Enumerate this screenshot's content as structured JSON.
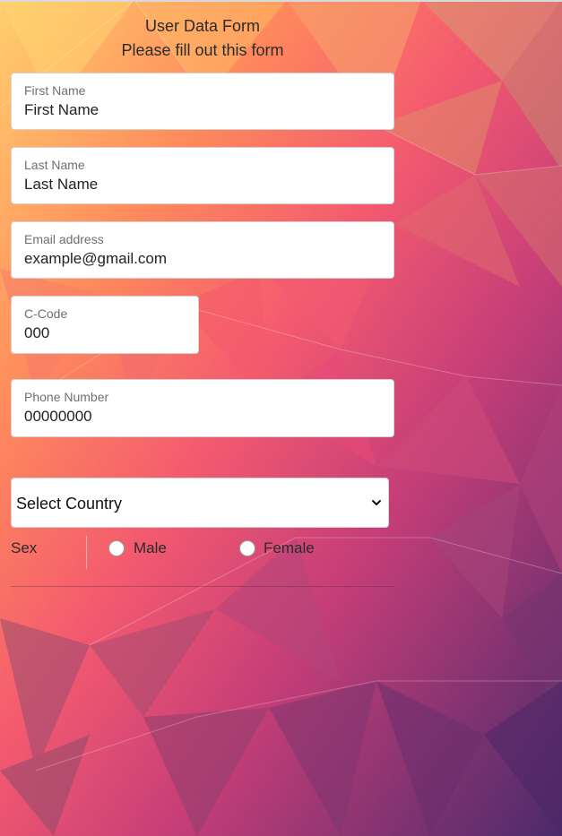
{
  "form": {
    "title": "User Data Form",
    "subtitle": "Please fill out this form"
  },
  "fields": {
    "first_name": {
      "label": "First Name",
      "placeholder": "First Name"
    },
    "last_name": {
      "label": "Last Name",
      "placeholder": "Last Name"
    },
    "email": {
      "label": "Email address",
      "placeholder": "example@gmail.com"
    },
    "c_code": {
      "label": "C-Code",
      "placeholder": "000"
    },
    "phone": {
      "label": "Phone Number",
      "placeholder": "00000000"
    }
  },
  "country_select": {
    "selected": "Select Country",
    "icon": "chevron-down-icon"
  },
  "sex": {
    "label": "Sex",
    "options": [
      "Male",
      "Female"
    ]
  },
  "colors": {
    "background_top": "#f7b267",
    "background_mid": "#e8516e",
    "background_bottom": "#5c2d6e",
    "field_bg": "#ffffff",
    "field_border": "#d2d2d2"
  }
}
